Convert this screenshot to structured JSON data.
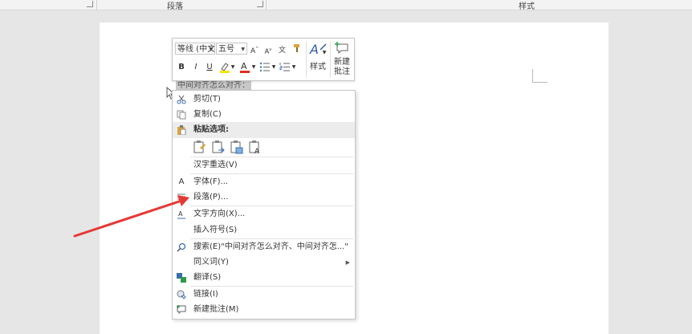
{
  "ribbon": {
    "paragraph_label": "段落",
    "styles_label": "样式"
  },
  "document": {
    "selected_text": "中间对齐怎么对齐："
  },
  "mini_toolbar": {
    "font_name": "等线 (中文",
    "font_size": "五号",
    "grow_font": "A",
    "shrink_font": "A",
    "bold": "B",
    "italic": "I",
    "underline": "U",
    "styles_label": "样式",
    "new_comment_line1": "新建",
    "new_comment_line2": "批注",
    "highlight_color": "#f5e400",
    "font_color": "#e0301e"
  },
  "context_menu": {
    "items": [
      {
        "label": "剪切(T)",
        "icon": "scissors-icon"
      },
      {
        "label": "复制(C)",
        "icon": "copy-icon"
      },
      {
        "label": "粘贴选项:",
        "icon": "paste-icon"
      },
      {
        "label": "汉字重选(V)",
        "icon": ""
      },
      {
        "label": "字体(F)...",
        "icon": "font-icon"
      },
      {
        "label": "段落(P)...",
        "icon": "paragraph-icon"
      },
      {
        "label": "文字方向(X)...",
        "icon": "text-direction-icon"
      },
      {
        "label": "插入符号(S)",
        "icon": ""
      },
      {
        "label": "搜索(E)\"中间对齐怎么对齐、中间对齐怎...\"",
        "icon": "search-icon"
      },
      {
        "label": "同义词(Y)",
        "icon": ""
      },
      {
        "label": "翻译(S)",
        "icon": "translate-icon"
      },
      {
        "label": "链接(I)",
        "icon": "link-icon"
      },
      {
        "label": "新建批注(M)",
        "icon": "comment-icon"
      }
    ],
    "font_icon_glyph": "A"
  },
  "annotation": {
    "arrow_color": "#e53935"
  }
}
